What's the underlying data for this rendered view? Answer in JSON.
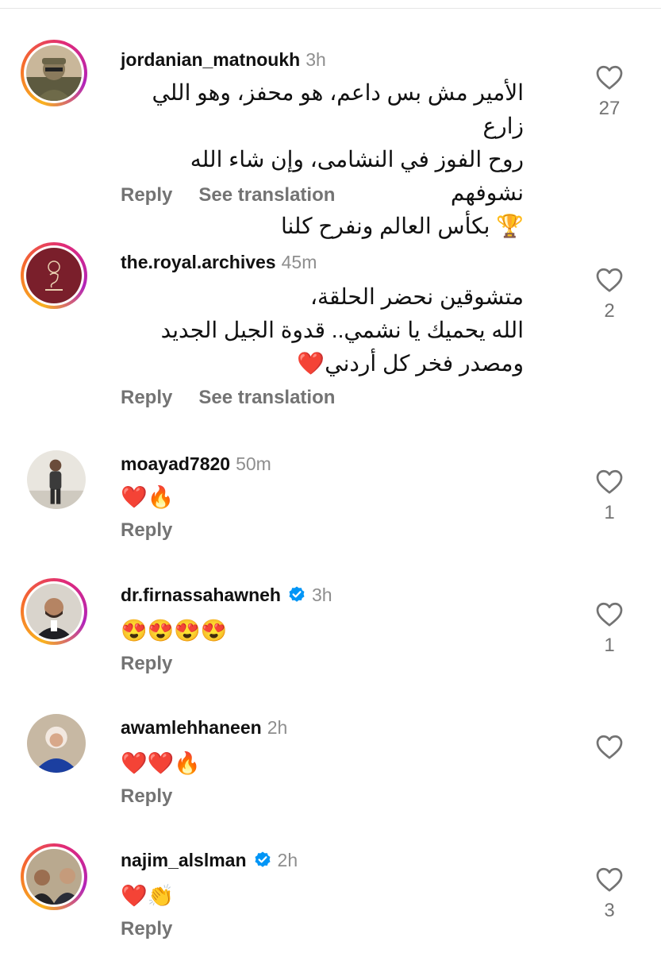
{
  "comments": [
    {
      "username": "jordanian_matnoukh",
      "time": "3h",
      "verified": false,
      "text_lines": [
        "الأمير مش بس داعم، هو محفز، وهو اللي زارع",
        "روح الفوز في النشامى، وإن شاء الله نشوفهم",
        "🏆 بكأس العالم ونفرح كلنا"
      ],
      "reply_label": "Reply",
      "translation_label": "See translation",
      "likes": "27"
    },
    {
      "username": "the.royal.archives",
      "time": "45m",
      "verified": false,
      "text_lines": [
        "متشوقين نحضر الحلقة،",
        "الله يحميك يا نشمي.. قدوة الجيل الجديد",
        "ومصدر فخر كل أردني❤️"
      ],
      "reply_label": "Reply",
      "translation_label": "See translation",
      "likes": "2"
    },
    {
      "username": "moayad7820",
      "time": "50m",
      "verified": false,
      "text": "❤️🔥",
      "reply_label": "Reply",
      "likes": "1"
    },
    {
      "username": "dr.firnassahawneh",
      "time": "3h",
      "verified": true,
      "text": "😍😍😍😍",
      "reply_label": "Reply",
      "likes": "1"
    },
    {
      "username": "awamlehhaneen",
      "time": "2h",
      "verified": false,
      "text": "❤️❤️🔥",
      "reply_label": "Reply",
      "likes": ""
    },
    {
      "username": "najim_alslman",
      "time": "2h",
      "verified": true,
      "text": "❤️👏",
      "reply_label": "Reply",
      "likes": "3"
    }
  ],
  "icons": {
    "like": "heart-outline-icon",
    "verified": "verified-badge-icon"
  },
  "colors": {
    "text": "#111111",
    "muted": "#737373",
    "time": "#8e8e8e",
    "verified": "#0095f6",
    "story_ring": [
      "#f9b21f",
      "#f56a2d",
      "#e02a78",
      "#b224ba"
    ]
  }
}
